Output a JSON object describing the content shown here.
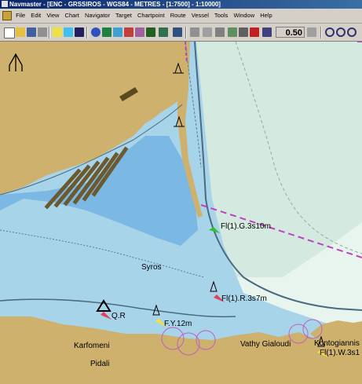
{
  "window": {
    "title": "Navmaster - [ENC - GRSSIROS - WGS84 - METRES - [1:7500] - 1:10000]"
  },
  "menu": {
    "items": [
      "File",
      "Edit",
      "View",
      "Chart",
      "Navigator",
      "Target",
      "Chartpoint",
      "Route",
      "Vessel",
      "Tools",
      "Window",
      "Help"
    ]
  },
  "toolbar": {
    "zoom_value": "0.50"
  },
  "chart": {
    "north_label": "N",
    "place_names": {
      "syros": "Syros",
      "karfomeni": "Karfomeni",
      "pidali": "Pidali",
      "vathy_gialoudi": "Vathy Gialoudi",
      "kontogiannis": "Kontogiannis"
    },
    "lights": {
      "fl_g": "Fl(1).G.3s10m",
      "fl_r": "Fl(1).R.3s7m",
      "fy": "F.Y.12m",
      "qr": "Q.R",
      "fl_w": "Fl(1).W.3s1"
    },
    "colors": {
      "land": "#cdb16c",
      "deep_water": "#e8f4ee",
      "medium_water": "#d4eae0",
      "shallow_water": "#a8d4ea",
      "harbour_water": "#7cb8e4",
      "route_line": "#c040c0",
      "light_red": "#e04060",
      "light_green": "#30c030",
      "light_yellow": "#f0e040"
    }
  }
}
